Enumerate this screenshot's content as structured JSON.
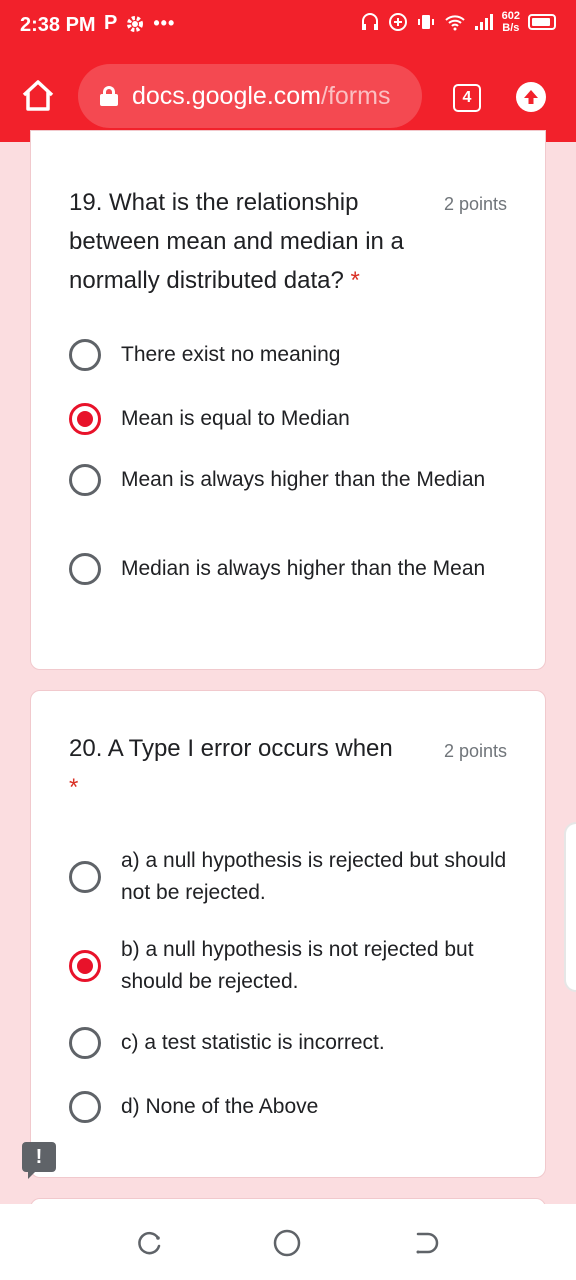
{
  "status_bar": {
    "time": "2:38 PM",
    "left_icons": [
      "P",
      "gear-icon",
      "•••"
    ],
    "net_speed_value": "602",
    "net_speed_unit": "B/s"
  },
  "browser": {
    "url_domain": "docs.google.com",
    "url_path": "/forms",
    "tab_count": "4"
  },
  "questions": [
    {
      "title": "19. What is the relationship between mean and median in a normally distributed data?",
      "required_mark": "*",
      "points": "2 points",
      "options": [
        {
          "label": "There exist no meaning",
          "checked": false
        },
        {
          "label": "Mean is equal to Median",
          "checked": true
        },
        {
          "label": "Mean is always higher than the Median",
          "checked": false
        },
        {
          "label": "Median is always higher than the Mean",
          "checked": false
        }
      ]
    },
    {
      "title": "20. A Type I error occurs when",
      "required_mark": "*",
      "points": "2 points",
      "options": [
        {
          "label": "a) a null hypothesis is rejected but should not be rejected.",
          "checked": false
        },
        {
          "label": "b) a null hypothesis is not rejected but should be rejected.",
          "checked": true
        },
        {
          "label": "c) a test statistic is incorrect.",
          "checked": false
        },
        {
          "label": "d) None of the Above",
          "checked": false
        }
      ]
    }
  ],
  "feedback_icon": "!",
  "colors": {
    "brand_red": "#f2212b",
    "radio_selected": "#e8122a",
    "page_bg": "#fbdde0"
  }
}
